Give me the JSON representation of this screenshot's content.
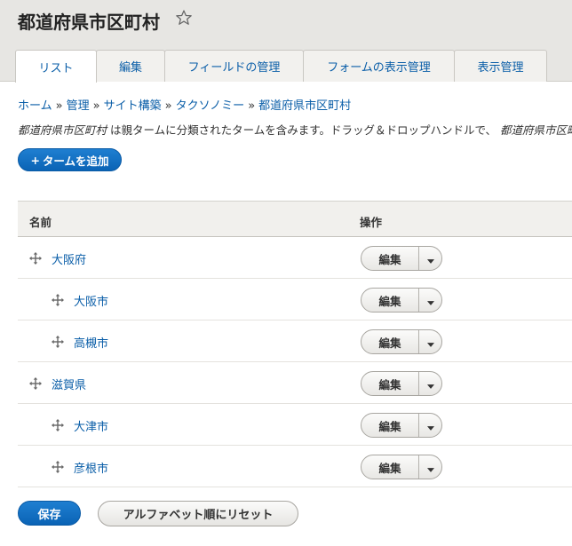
{
  "header": {
    "title": "都道府県市区町村"
  },
  "tabs": [
    {
      "label": "リスト",
      "active": true
    },
    {
      "label": "編集",
      "active": false
    },
    {
      "label": "フィールドの管理",
      "active": false
    },
    {
      "label": "フォームの表示管理",
      "active": false
    },
    {
      "label": "表示管理",
      "active": false
    }
  ],
  "breadcrumb": [
    {
      "label": "ホーム"
    },
    {
      "label": "管理"
    },
    {
      "label": "サイト構築"
    },
    {
      "label": "タクソノミー"
    },
    {
      "label": "都道府県市区町村"
    }
  ],
  "breadcrumb_separator": "»",
  "description": {
    "vocab_name": "都道府県市区町村",
    "text": " は親タームに分類されたタームを含みます。ドラッグ＆ドロップハンドルで、",
    "vocab_name_2": "都道府県市区町村"
  },
  "add_button": {
    "plus": "+",
    "label": "タームを追加"
  },
  "table": {
    "headers": {
      "name": "名前",
      "operations": "操作"
    },
    "edit_label": "編集",
    "rows": [
      {
        "name": "大阪府",
        "depth": 0
      },
      {
        "name": "大阪市",
        "depth": 1
      },
      {
        "name": "高槻市",
        "depth": 1
      },
      {
        "name": "滋賀県",
        "depth": 0
      },
      {
        "name": "大津市",
        "depth": 1
      },
      {
        "name": "彦根市",
        "depth": 1
      }
    ]
  },
  "actions": {
    "save_label": "保存",
    "reset_label": "アルファベット順にリセット"
  },
  "colors": {
    "link": "#0a5ea8",
    "primary_button": "#0a63b5",
    "header_bg": "#e7e6e3"
  },
  "icons": {
    "favorite": "star-outline-icon",
    "drag": "drag-handle-icon",
    "dropdown": "caret-down-icon"
  }
}
